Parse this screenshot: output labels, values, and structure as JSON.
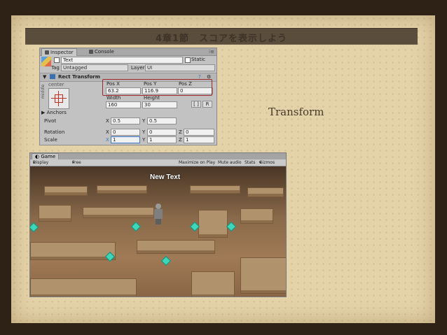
{
  "slide": {
    "title": "4章1節　スコアを表示しよう",
    "side_label": "Transform"
  },
  "inspector": {
    "tabs": [
      "Inspector",
      "Console"
    ],
    "object_name": "Text",
    "static_label": "Static",
    "tag_label": "Tag",
    "tag_value": "Untagged",
    "layer_label": "Layer",
    "layer_value": "UI",
    "component_title": "Rect Transform",
    "anchor_h": "center",
    "anchor_v": "middle",
    "pos_headers": [
      "Pos X",
      "Pos Y",
      "Pos Z"
    ],
    "pos_values": [
      "63.2",
      "116.9",
      "0"
    ],
    "size_headers": [
      "Width",
      "Height"
    ],
    "size_values": [
      "160",
      "30"
    ],
    "anchors_label": "Anchors",
    "pivot_label": "Pivot",
    "pivot": {
      "x_label": "X",
      "x": "0.5",
      "y_label": "Y",
      "y": "0.5"
    },
    "rotation_label": "Rotation",
    "rotation": {
      "x_label": "X",
      "x": "0",
      "y_label": "Y",
      "y": "0",
      "z_label": "Z",
      "z": "0"
    },
    "scale_label": "Scale",
    "scale": {
      "x_label": "X",
      "x": "1",
      "y_label": "Y",
      "y": "1",
      "z_label": "Z",
      "z": "1"
    },
    "blueprint_btn": "[ ]",
    "r_btn": "R"
  },
  "game": {
    "tab_title": "Game",
    "display": "Display 1",
    "aspect": "Free Aspect",
    "maximize": "Maximize on Play",
    "mute": "Mute audio",
    "stats": "Stats",
    "gizmos": "Gizmos",
    "overlay_text": "New Text"
  }
}
